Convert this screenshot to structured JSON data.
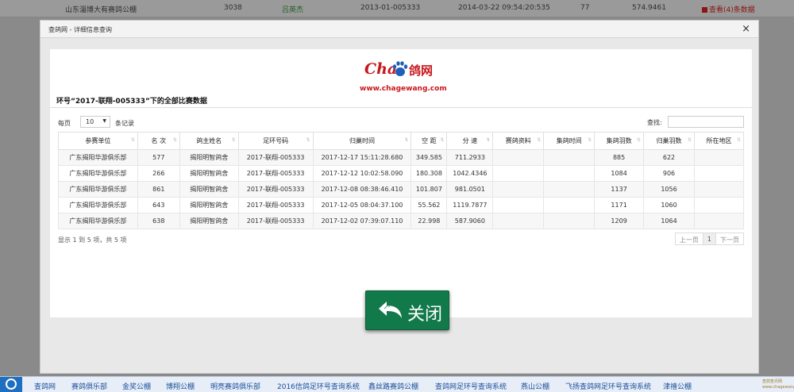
{
  "background_row": {
    "venue": "山东淄博大有赛鸽公棚",
    "num": "3038",
    "owner": "吕英杰",
    "ring": "2013-01-005333",
    "time": "2014-03-22 09:54:20:535",
    "rank": "77",
    "speed": "574.9461",
    "view_link": "查看(4)条数据"
  },
  "modal": {
    "title": "查鸽网 - 详细信息查询",
    "close_symbol": "×"
  },
  "logo": {
    "cha": "Cha",
    "ge": "鸽网",
    "site": "www.chagewang.com"
  },
  "ring_title": "环号“2017-联翔-005333”下的全部比赛数据",
  "controls": {
    "per_page_prefix": "每页",
    "per_page_value": "10",
    "per_page_suffix": "条记录",
    "search_label": "查找:"
  },
  "table": {
    "headers": [
      "参赛单位",
      "名 次",
      "鸽主姓名",
      "足环号码",
      "归巢时间",
      "空 距",
      "分 速",
      "赛鸽资料",
      "集鸽时间",
      "集鸽羽数",
      "归巢羽数",
      "所在地区"
    ],
    "rows": [
      [
        "广东揭阳华游俱乐部",
        "577",
        "揭阳明智鸽舍",
        "2017-联翔-005333",
        "2017-12-17 15:11:28.680",
        "349.585",
        "711.2933",
        "",
        "",
        "885",
        "622",
        ""
      ],
      [
        "广东揭阳华游俱乐部",
        "266",
        "揭阳明智鸽舍",
        "2017-联翔-005333",
        "2017-12-12 10:02:58.090",
        "180.308",
        "1042.4346",
        "",
        "",
        "1084",
        "906",
        ""
      ],
      [
        "广东揭阳华游俱乐部",
        "861",
        "揭阳明智鸽舍",
        "2017-联翔-005333",
        "2017-12-08 08:38:46.410",
        "101.807",
        "981.0501",
        "",
        "",
        "1137",
        "1056",
        ""
      ],
      [
        "广东揭阳华游俱乐部",
        "643",
        "揭阳明智鸽舍",
        "2017-联翔-005333",
        "2017-12-05 08:04:37.100",
        "55.562",
        "1119.7877",
        "",
        "",
        "1171",
        "1060",
        ""
      ],
      [
        "广东揭阳华游俱乐部",
        "638",
        "揭阳明智鸽舍",
        "2017-联翔-005333",
        "2017-12-02 07:39:07.110",
        "22.998",
        "587.9060",
        "",
        "",
        "1209",
        "1064",
        ""
      ]
    ]
  },
  "footer": {
    "info": "显示 1 到 5 项，共 5 项",
    "prev": "上一页",
    "page": "1",
    "next": "下一页"
  },
  "close_button": {
    "label": "关闭"
  },
  "bottom_nav": {
    "links": [
      "查鸽网",
      "赛鸽俱乐部",
      "金奖公棚",
      "博翔公棚",
      "明亮赛鸽俱乐部",
      "2016信鸽足环号查询系统",
      "鑫丝路赛鸽公棚",
      "查鸽网足环号查询系统",
      "燕山公棚",
      "飞扬查鸽网足环号查询系统",
      "津禧公棚"
    ],
    "watermark": "查鸽查讯网 www.chagewang.com"
  },
  "colors": {
    "brand_red": "#c8161d",
    "button_green": "#127a4a",
    "link_blue": "#1a4f9c"
  },
  "icons": [
    "paw-logo-icon",
    "back-arrow-icon",
    "sort-icon",
    "close-icon",
    "start-icon"
  ]
}
